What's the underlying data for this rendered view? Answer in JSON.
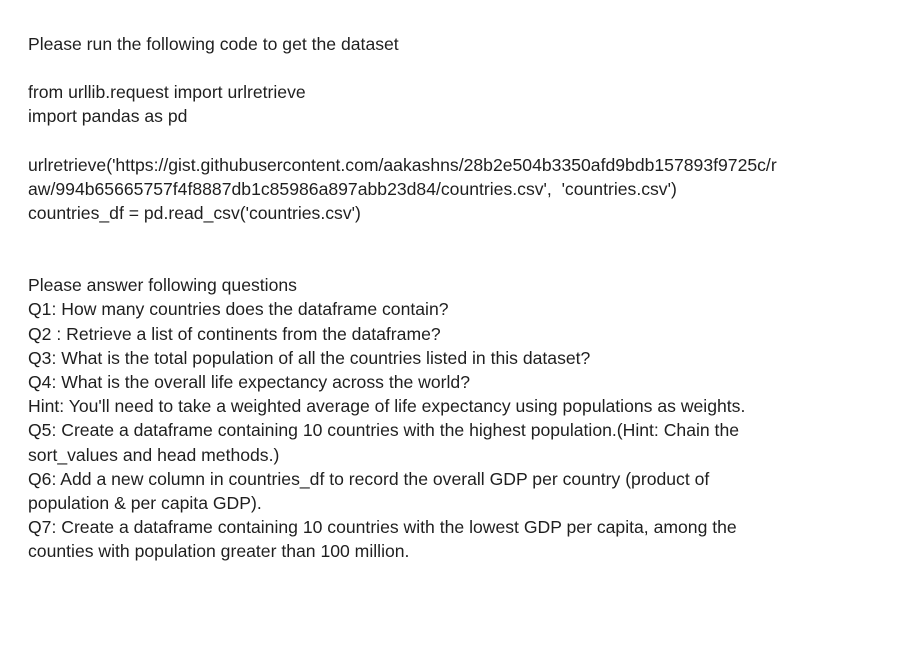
{
  "intro": "Please run the following code to get the dataset",
  "code": {
    "import1": "from urllib.request import urlretrieve",
    "import2": "import pandas as pd",
    "retrieve_line1": "urlretrieve('https://gist.githubusercontent.com/aakashns/28b2e504b3350afd9bdb157893f9725c/r",
    "retrieve_line2": "aw/994b65665757f4f8887db1c85986a897abb23d84/countries.csv',  'countries.csv')",
    "read_csv": "countries_df = pd.read_csv('countries.csv')"
  },
  "questions_header": "Please answer following questions",
  "questions": [
    "Q1: How many countries does the dataframe contain?",
    "Q2 : Retrieve a list of continents from the dataframe?",
    "Q3: What is the total population of all the countries listed in this dataset?",
    "Q4: What is the overall life expectancy across the world?",
    "Hint: You'll need to take a weighted average of life expectancy using populations as weights.",
    "Q5: Create a dataframe containing 10 countries with the highest population.(Hint: Chain the",
    "sort_values and head methods.)",
    "Q6: Add a new column in countries_df to record the overall GDP per country (product of",
    "population & per capita GDP).",
    "Q7: Create a dataframe containing 10 countries with the lowest GDP per capita, among the",
    "counties with population greater than 100 million."
  ]
}
